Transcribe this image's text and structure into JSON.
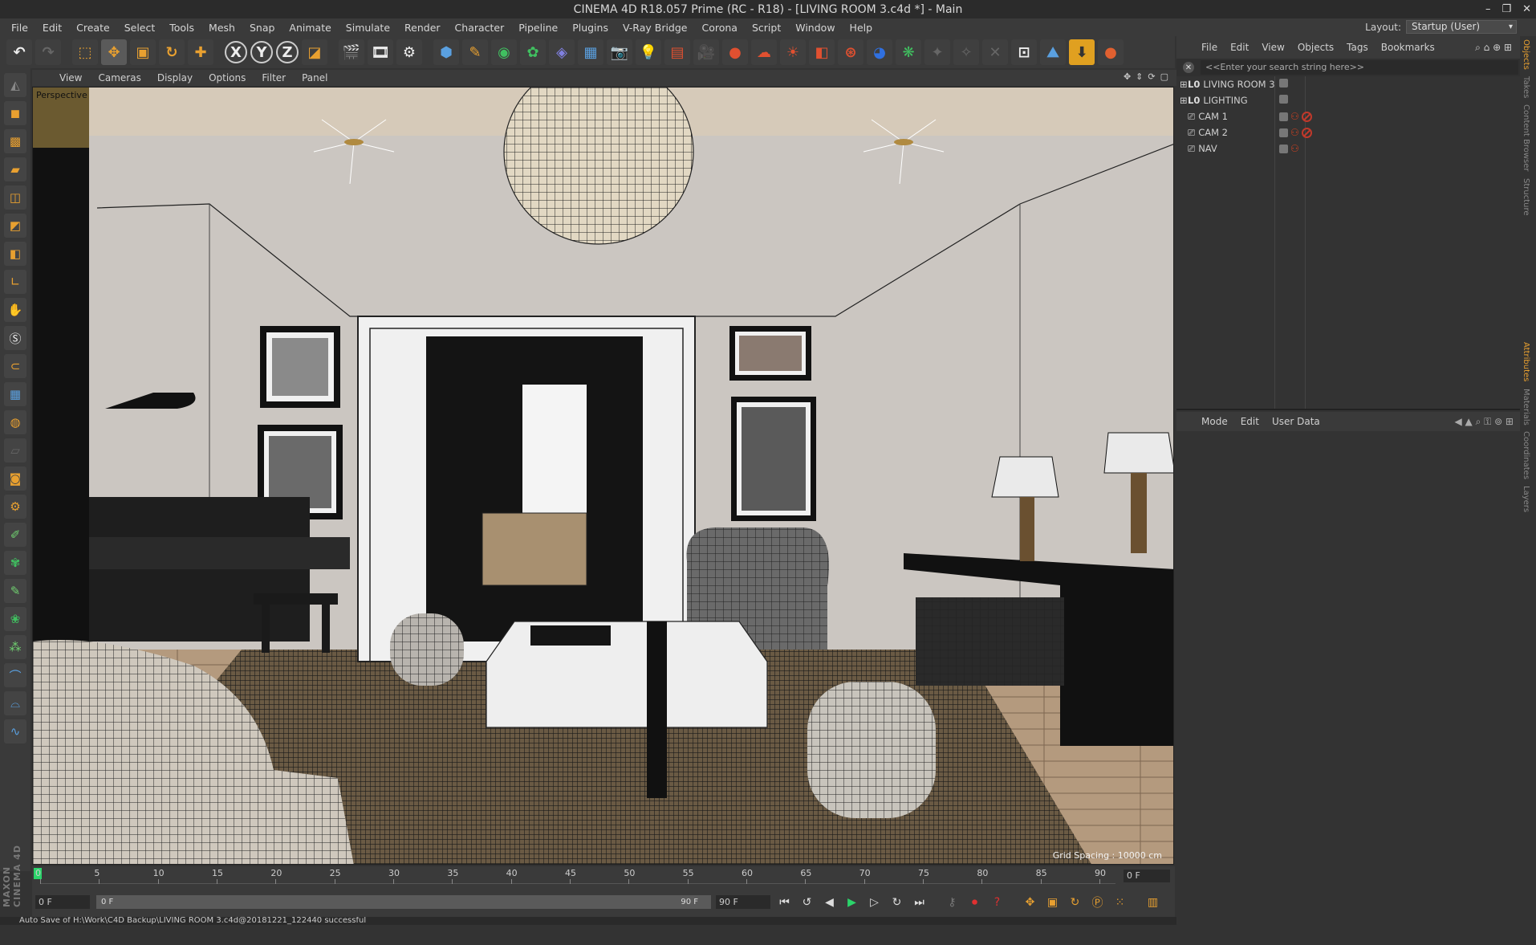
{
  "app": {
    "window_title": "CINEMA 4D R18.057 Prime (RC - R18) - [LIVING ROOM 3.c4d *] - Main",
    "window_controls": [
      "–",
      "❐",
      "✕"
    ]
  },
  "menubar": {
    "items": [
      "File",
      "Edit",
      "Create",
      "Select",
      "Tools",
      "Mesh",
      "Snap",
      "Animate",
      "Simulate",
      "Render",
      "Character",
      "Pipeline",
      "Plugins",
      "V-Ray Bridge",
      "Corona",
      "Script",
      "Window",
      "Help"
    ],
    "layout_label": "Layout:",
    "layout_value": "Startup (User)"
  },
  "toolbar": {
    "axis_x": "X",
    "axis_y": "Y",
    "axis_z": "Z"
  },
  "viewport": {
    "menu": [
      "View",
      "Cameras",
      "Display",
      "Options",
      "Filter",
      "Panel"
    ],
    "label": "Perspective",
    "grid_spacing": "Grid Spacing : 10000 cm"
  },
  "objects_panel": {
    "menu": [
      "File",
      "Edit",
      "View",
      "Objects",
      "Tags",
      "Bookmarks"
    ],
    "search_placeholder": "<<Enter your search string here>>",
    "objects": [
      {
        "name": "LIVING ROOM 3",
        "type": "layer"
      },
      {
        "name": "LIGHTING",
        "type": "layer"
      },
      {
        "name": "CAM 1",
        "type": "camera"
      },
      {
        "name": "CAM 2",
        "type": "camera"
      },
      {
        "name": "NAV",
        "type": "camera"
      }
    ]
  },
  "attributes_panel": {
    "menu": [
      "Mode",
      "Edit",
      "User Data"
    ]
  },
  "right_tabs": [
    "Objects",
    "Takes",
    "Content Browser",
    "Structure",
    "Attributes",
    "Materials",
    "Coordinates",
    "Layers"
  ],
  "timeline": {
    "ticks": [
      "0",
      "5",
      "10",
      "15",
      "20",
      "25",
      "30",
      "35",
      "40",
      "45",
      "50",
      "55",
      "60",
      "65",
      "70",
      "75",
      "80",
      "85",
      "90"
    ],
    "current_frame": "0 F",
    "start_field": "0 F",
    "slider_left": "0 F",
    "slider_right": "90 F",
    "end_field": "90 F"
  },
  "status": {
    "text": "Auto Save of H:\\Work\\C4D Backup\\LIVING ROOM 3.c4d@20181221_122440 successful"
  },
  "colors": {
    "ui_dark": "#333333",
    "ui_mid": "#3a3a3a",
    "accent_orange": "#e8a030",
    "timeline_marker": "#2bd46a",
    "tag_red": "#c0392b"
  }
}
